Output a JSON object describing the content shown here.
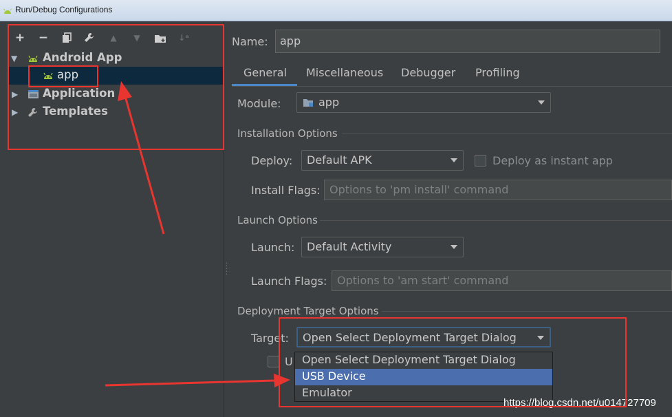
{
  "window": {
    "title": "Run/Debug Configurations",
    "icon": "android-icon"
  },
  "toolbar": {
    "buttons": [
      {
        "name": "add-icon",
        "glyph": "+"
      },
      {
        "name": "remove-icon",
        "glyph": "−"
      },
      {
        "name": "copy-icon",
        "glyph": "⧉"
      },
      {
        "name": "wrench-icon",
        "glyph": "🔧"
      },
      {
        "name": "move-up-icon",
        "glyph": "▲"
      },
      {
        "name": "move-down-icon",
        "glyph": "▼"
      },
      {
        "name": "folder-add-icon",
        "glyph": "📁"
      },
      {
        "name": "sort-icon",
        "glyph": "↓a"
      }
    ]
  },
  "tree": {
    "android_app": "Android App",
    "app": "app",
    "application": "Application",
    "templates": "Templates"
  },
  "config": {
    "name_label": "Name:",
    "name_value": "app",
    "tabs": [
      "General",
      "Miscellaneous",
      "Debugger",
      "Profiling"
    ],
    "active_tab": "General",
    "module_label": "Module:",
    "module_value": "app",
    "installation_section": "Installation Options",
    "deploy_label": "Deploy:",
    "deploy_value": "Default APK",
    "instant_app_label": "Deploy as instant app",
    "install_flags_label": "Install Flags:",
    "install_flags_placeholder": "Options to 'pm install' command",
    "launch_section": "Launch Options",
    "launch_label": "Launch:",
    "launch_value": "Default Activity",
    "launch_flags_label": "Launch Flags:",
    "launch_flags_placeholder": "Options to 'am start' command",
    "deployment_section": "Deployment Target Options",
    "target_label": "Target:",
    "target_value": "Open Select Deployment Target Dialog",
    "hidden_checkbox_label_fragment": "U",
    "target_options": [
      "Open Select Deployment Target Dialog",
      "USB Device",
      "Emulator"
    ],
    "highlighted_option": "USB Device"
  },
  "watermark": "https://blog.csdn.net/u014727709",
  "colors": {
    "annotation_red": "#e8352f",
    "selection": "#4b6eaf",
    "tab_accent": "#4a88c7",
    "android_green": "#a4c639"
  }
}
